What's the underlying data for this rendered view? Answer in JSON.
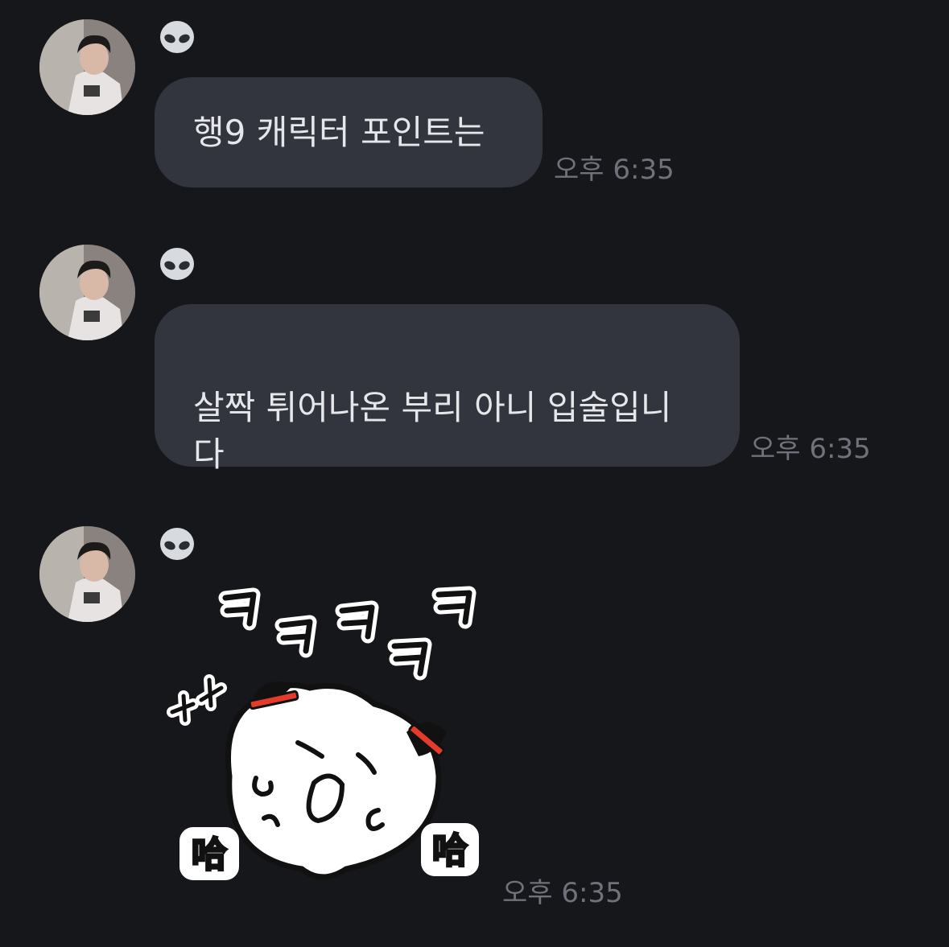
{
  "messages": [
    {
      "sender_emoji": "👽",
      "text": "행9 캐릭터 포인트는",
      "time": "오후 6:35"
    },
    {
      "sender_emoji": "👽",
      "text": "살짝 튀어나온 부리 아니 입술입니\n다",
      "time": "오후 6:35"
    },
    {
      "sender_emoji": "👽",
      "sticker": "laughing-dumpling-sticker",
      "sticker_text": "ㅋㅋㅋㅋㅋ",
      "sticker_chars": [
        "哈",
        "哈"
      ],
      "time": "오후 6:35"
    }
  ],
  "colors": {
    "background": "#16171b",
    "bubble": "#32353d",
    "bubble_text": "#e6e7ea",
    "timestamp": "#6f727a"
  }
}
